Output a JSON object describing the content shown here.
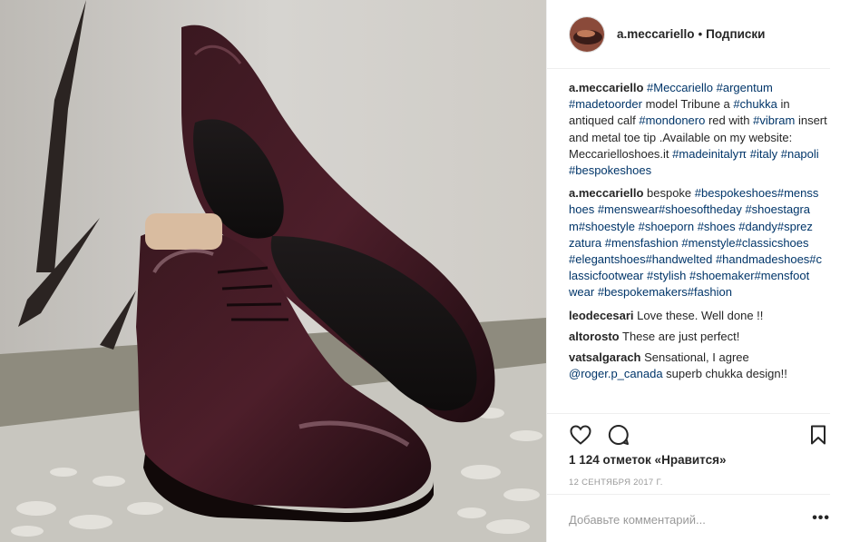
{
  "post": {
    "image_alt": "Burgundy leather chukka boots",
    "header": {
      "username": "a.meccariello",
      "separator": "•",
      "follow_label": "Подписки"
    },
    "comments": [
      {
        "user": "a.meccariello",
        "parts": [
          {
            "t": "tag",
            "v": "#Meccariello"
          },
          {
            "t": "text",
            "v": " "
          },
          {
            "t": "tag",
            "v": "#argentum"
          },
          {
            "t": "text",
            "v": " "
          },
          {
            "t": "tag",
            "v": "#madetoorder"
          },
          {
            "t": "text",
            "v": " model Tribune a "
          },
          {
            "t": "tag",
            "v": "#chukka"
          },
          {
            "t": "text",
            "v": " in antiqued calf "
          },
          {
            "t": "tag",
            "v": "#mondonero"
          },
          {
            "t": "text",
            "v": " red with "
          },
          {
            "t": "tag",
            "v": "#vibram"
          },
          {
            "t": "text",
            "v": " insert and metal toe tip .Available on my website: Meccarielloshoes.it "
          },
          {
            "t": "tag",
            "v": "#madeinitalyπ"
          },
          {
            "t": "text",
            "v": " "
          },
          {
            "t": "tag",
            "v": "#italy"
          },
          {
            "t": "text",
            "v": " "
          },
          {
            "t": "tag",
            "v": "#napoli"
          },
          {
            "t": "text",
            "v": " "
          },
          {
            "t": "tag",
            "v": "#bespokeshoes"
          }
        ]
      },
      {
        "user": "a.meccariello",
        "parts": [
          {
            "t": "text",
            "v": "bespoke "
          },
          {
            "t": "tag",
            "v": "#bespokeshoes#menss hoes"
          },
          {
            "t": "text",
            "v": " "
          },
          {
            "t": "tag",
            "v": "#menswear#shoesoftheday"
          },
          {
            "t": "text",
            "v": " "
          },
          {
            "t": "tag",
            "v": "#shoestagra m#shoestyle"
          },
          {
            "t": "text",
            "v": " "
          },
          {
            "t": "tag",
            "v": "#shoeporn"
          },
          {
            "t": "text",
            "v": " "
          },
          {
            "t": "tag",
            "v": "#shoes"
          },
          {
            "t": "text",
            "v": " "
          },
          {
            "t": "tag",
            "v": "#dandy#sprez zatura"
          },
          {
            "t": "text",
            "v": " "
          },
          {
            "t": "tag",
            "v": "#mensfashion"
          },
          {
            "t": "text",
            "v": " "
          },
          {
            "t": "tag",
            "v": "#menstyle#classicshoes"
          },
          {
            "t": "text",
            "v": " "
          },
          {
            "t": "tag",
            "v": "#elegantshoes#handwelted"
          },
          {
            "t": "text",
            "v": " "
          },
          {
            "t": "tag",
            "v": "#handmadeshoes#c lassicfootwear"
          },
          {
            "t": "text",
            "v": " "
          },
          {
            "t": "tag",
            "v": "#stylish"
          },
          {
            "t": "text",
            "v": " "
          },
          {
            "t": "tag",
            "v": "#shoemaker#mensfoot wear"
          },
          {
            "t": "text",
            "v": " "
          },
          {
            "t": "tag",
            "v": "#bespokemakers#fashion"
          }
        ]
      },
      {
        "user": "leodecesari",
        "parts": [
          {
            "t": "text",
            "v": " Love these. Well done !!"
          }
        ]
      },
      {
        "user": "altorosto",
        "parts": [
          {
            "t": "text",
            "v": " These are just perfect!"
          }
        ]
      },
      {
        "user": "vatsalgarach",
        "parts": [
          {
            "t": "text",
            "v": " Sensational, I agree "
          },
          {
            "t": "tag",
            "v": "@roger.p_canada"
          },
          {
            "t": "text",
            "v": " superb chukka design!!"
          }
        ]
      }
    ],
    "actions": {
      "like_icon": "heart-icon",
      "comment_icon": "comment-icon",
      "save_icon": "bookmark-icon"
    },
    "likes_text": "1 124 отметок «Нравится»",
    "date_text": "12 сентября 2017 г.",
    "add_comment_placeholder": "Добавьте комментарий...",
    "more_label": "•••",
    "colors": {
      "link": "#003569",
      "text": "#262626",
      "muted": "#999999",
      "border": "#efefef"
    }
  }
}
